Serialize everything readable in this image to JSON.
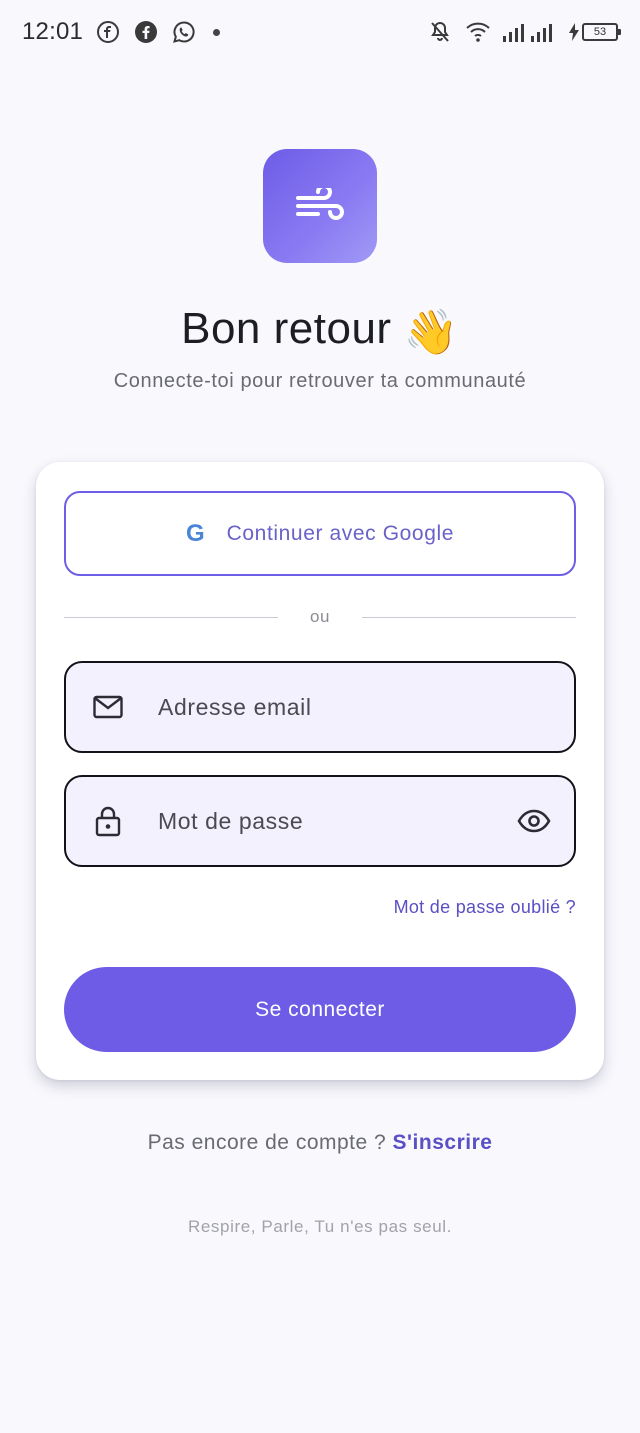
{
  "status_bar": {
    "time": "12:01",
    "battery": "53"
  },
  "login": {
    "title": "Bon retour",
    "title_emoji": "👋",
    "subtitle": "Connecte-toi pour retrouver ta communauté",
    "google_button_label": "Continuer avec Google",
    "google_glyph": "G",
    "divider_text": "ou",
    "email_placeholder": "Adresse email",
    "password_placeholder": "Mot de passe",
    "forgot_password": "Mot de passe oublié ?",
    "submit_label": "Se connecter",
    "signup_prompt": "Pas encore de compte ? ",
    "signup_link": "S'inscrire",
    "tagline": "Respire, Parle, Tu n'es pas seul."
  },
  "icons": {
    "logo": "wind-icon",
    "email": "mail-icon",
    "password": "lock-icon",
    "visibility": "eye-icon"
  },
  "colors": {
    "primary": "#6e5ce7",
    "link": "#5a4fc4",
    "google_blue": "#4a85d8",
    "field_bg": "#f3f1fd",
    "page_bg": "#f8f8fd"
  }
}
